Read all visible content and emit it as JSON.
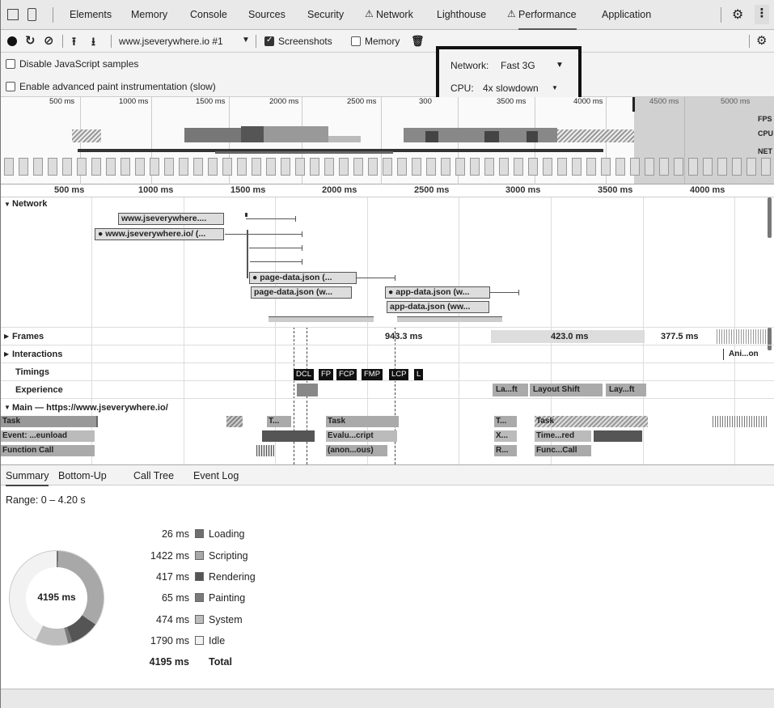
{
  "tabs": {
    "items": [
      "Elements",
      "Memory",
      "Console",
      "Sources",
      "Security",
      "Network",
      "Lighthouse",
      "Performance",
      "Application"
    ]
  },
  "toolbar": {
    "profile_select": "www.jseverywhere.io #1",
    "screenshots_label": "Screenshots",
    "screenshots_checked": true,
    "memory_label": "Memory",
    "memory_checked": false
  },
  "settings": {
    "disable_js_samples": "Disable JavaScript samples",
    "enable_paint": "Enable advanced paint instrumentation (slow)",
    "network_label": "Network:",
    "network_value": "Fast 3G",
    "cpu_label": "CPU:",
    "cpu_value": "4x slowdown"
  },
  "overview": {
    "ticks": [
      "500 ms",
      "1000 ms",
      "1500 ms",
      "2000 ms",
      "2500 ms",
      "300",
      "3500 ms",
      "4000 ms",
      "4500 ms",
      "5000 ms"
    ],
    "labels": [
      "FPS",
      "CPU",
      "NET"
    ]
  },
  "ruler": {
    "ticks": [
      "500 ms",
      "1000 ms",
      "1500 ms",
      "2000 ms",
      "2500 ms",
      "3000 ms",
      "3500 ms",
      "4000 ms"
    ]
  },
  "network": {
    "title": "Network",
    "requests": [
      "www.jseverywhere....",
      "www.jseverywhere.io/ (...",
      "page-data.json (...",
      "page-data.json (w...",
      "app-data.json (w...",
      "app-data.json (ww..."
    ]
  },
  "tracks": {
    "frames": "Frames",
    "frames_values": [
      "943.3 ms",
      "423.0 ms",
      "377.5 ms"
    ],
    "interactions": "Interactions",
    "interactions_value": "Ani...on",
    "timings": "Timings",
    "timing_badges": [
      "DCL",
      "FP",
      "FCP",
      "FMP",
      "LCP",
      "L"
    ],
    "experience": "Experience",
    "experience_items": [
      "La...ft",
      "Layout Shift",
      "Lay...ft"
    ],
    "main_title": "Main — https://www.jseverywhere.io/"
  },
  "flame": {
    "row1": [
      "Task",
      "T...",
      "Task",
      "T...",
      "Task"
    ],
    "row2": [
      "Event: ...eunload",
      "Evalu...cript",
      "X...",
      "Time...red"
    ],
    "row3": [
      "Function Call",
      "(anon...ous)",
      "R...",
      "Func...Call"
    ]
  },
  "bottom_tabs": [
    "Summary",
    "Bottom-Up",
    "Call Tree",
    "Event Log"
  ],
  "summary": {
    "range": "Range: 0 – 4.20 s",
    "total_center": "4195 ms",
    "rows": [
      {
        "ms": "26 ms",
        "label": "Loading",
        "color": "#6f6f6f"
      },
      {
        "ms": "1422 ms",
        "label": "Scripting",
        "color": "#a8a8a8"
      },
      {
        "ms": "417 ms",
        "label": "Rendering",
        "color": "#555555"
      },
      {
        "ms": "65 ms",
        "label": "Painting",
        "color": "#7a7a7a"
      },
      {
        "ms": "474 ms",
        "label": "System",
        "color": "#bdbdbd"
      },
      {
        "ms": "1790 ms",
        "label": "Idle",
        "color": "#f2f2f2"
      }
    ],
    "total_ms": "4195 ms",
    "total_label": "Total"
  }
}
